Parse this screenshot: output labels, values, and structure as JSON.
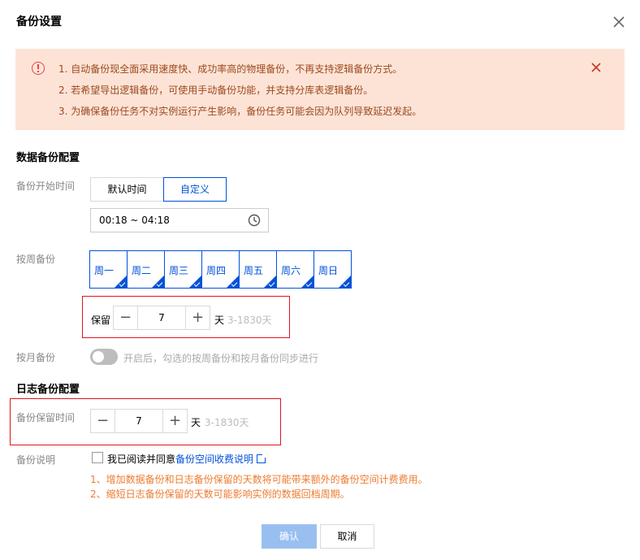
{
  "dialog": {
    "title": "备份设置"
  },
  "alert": {
    "lines": [
      "1. 自动备份现全面采用速度快、成功率高的物理备份，不再支持逻辑备份方式。",
      "2. 若希望导出逻辑备份，可使用手动备份功能，并支持分库表逻辑备份。",
      "3. 为确保备份任务不对实例运行产生影响，备份任务可能会因为队列导致延迟发起。"
    ]
  },
  "data_backup": {
    "section_title": "数据备份配置",
    "start_time_label": "备份开始时间",
    "time_modes": [
      "默认时间",
      "自定义"
    ],
    "selected_mode": "自定义",
    "time_range": "00:18 ~ 04:18",
    "weekly_label": "按周备份",
    "days": [
      {
        "label": "周一",
        "checked": true
      },
      {
        "label": "周二",
        "checked": true
      },
      {
        "label": "周三",
        "checked": true
      },
      {
        "label": "周四",
        "checked": true
      },
      {
        "label": "周五",
        "checked": true
      },
      {
        "label": "周六",
        "checked": true
      },
      {
        "label": "周日",
        "checked": true
      }
    ],
    "retain_label": "保留",
    "retain_value": "7",
    "retain_unit": "天",
    "retain_range": "3-1830天",
    "monthly_label": "按月备份",
    "monthly_enabled": false,
    "monthly_hint": "开启后，勾选的按周备份和按月备份同步进行"
  },
  "log_backup": {
    "section_title": "日志备份配置",
    "retain_label": "备份保留时间",
    "retain_value": "7",
    "retain_unit": "天",
    "retain_range": "3-1830天"
  },
  "description": {
    "label": "备份说明",
    "agree_text": "我已阅读并同意",
    "agree_link": "备份空间收费说明",
    "agreed": false,
    "notes": [
      "1、增加数据备份和日志备份保留的天数将可能带来额外的备份空间计费费用。",
      "2、缩短日志备份保留的天数可能影响实例的数据回档周期。"
    ]
  },
  "footer": {
    "confirm_label": "确认",
    "cancel_label": "取消"
  },
  "colors": {
    "primary": "#0052d9",
    "alert_bg": "#fde3d6",
    "alert_text": "#9c4a1e",
    "warn": "#ed7b2f",
    "highlight_box": "#e1141e"
  },
  "icons": {
    "close": "close-icon",
    "alert": "warning-circle-icon",
    "clock": "clock-icon",
    "checkmark": "check-icon",
    "external": "external-link-icon"
  }
}
